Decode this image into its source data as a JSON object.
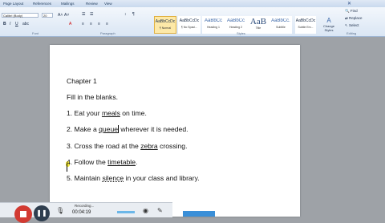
{
  "ribbon": {
    "tabs": [
      "Page Layout",
      "References",
      "Mailings",
      "Review",
      "View"
    ],
    "font_name": "Calibri (Body)",
    "font_size": "20",
    "group_labels": [
      "Font",
      "Paragraph",
      "Styles",
      "Editing"
    ],
    "styles": [
      {
        "sample": "AaBbCcDc",
        "name": "¶ Normal"
      },
      {
        "sample": "AaBbCcDc",
        "name": "¶ No Spaci..."
      },
      {
        "sample": "AaBbCc",
        "name": "Heading 1"
      },
      {
        "sample": "AaBbCc",
        "name": "Heading 2"
      },
      {
        "sample": "AaB",
        "name": "Title"
      },
      {
        "sample": "AaBbCc.",
        "name": "Subtitle"
      },
      {
        "sample": "AaBbCcDc",
        "name": "Subtle Em..."
      }
    ],
    "change_styles": "Change Styles",
    "editing": [
      "Find",
      "Replace",
      "Select"
    ]
  },
  "document": {
    "lines": [
      {
        "pre": "Chapter 1",
        "u": "",
        "post": ""
      },
      {
        "pre": "Fill in the blanks.",
        "u": "",
        "post": ""
      },
      {
        "pre": "1. Eat your ",
        "u": "meals",
        "post": " on time."
      },
      {
        "pre": "2. Make a ",
        "u": "queue",
        "post": " wherever it is needed."
      },
      {
        "pre": "3. Cross the road at the ",
        "u": "zebra",
        "post": " crossing."
      },
      {
        "pre": "4. Follow the ",
        "u": "timetable",
        "post": "."
      },
      {
        "pre": "5. Maintain ",
        "u": "silence",
        "post": " in your class and library."
      }
    ]
  },
  "recorder": {
    "status": "Recording...",
    "time": "00:04:19"
  }
}
